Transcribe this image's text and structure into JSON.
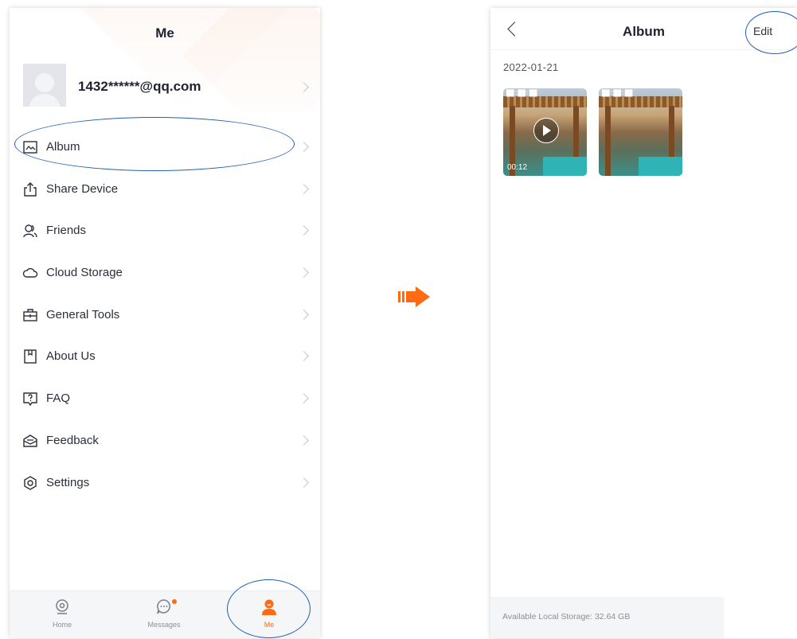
{
  "me_page": {
    "title": "Me",
    "account": {
      "email": "1432******@qq.com"
    },
    "menu": [
      {
        "label": "Album",
        "icon": "image-icon"
      },
      {
        "label": "Share Device",
        "icon": "share-icon"
      },
      {
        "label": "Friends",
        "icon": "friends-icon"
      },
      {
        "label": "Cloud Storage",
        "icon": "cloud-icon"
      },
      {
        "label": "General Tools",
        "icon": "toolbox-icon"
      },
      {
        "label": "About Us",
        "icon": "bookmark-icon"
      },
      {
        "label": "FAQ",
        "icon": "question-icon"
      },
      {
        "label": "Feedback",
        "icon": "feedback-icon"
      },
      {
        "label": "Settings",
        "icon": "gear-icon"
      }
    ],
    "tabs": [
      {
        "label": "Home",
        "icon": "camera-icon",
        "active": false
      },
      {
        "label": "Messages",
        "icon": "chat-icon",
        "active": false,
        "badge": true
      },
      {
        "label": "Me",
        "icon": "user-icon",
        "active": true
      }
    ]
  },
  "album_page": {
    "title": "Album",
    "edit_label": "Edit",
    "date": "2022-01-21",
    "items": [
      {
        "type": "video",
        "duration": "00:12"
      },
      {
        "type": "image"
      }
    ],
    "storage_text": "Available Local Storage: 32.64 GB"
  },
  "colors": {
    "accent": "#ff6a13",
    "annotation": "#1f5fb4"
  }
}
